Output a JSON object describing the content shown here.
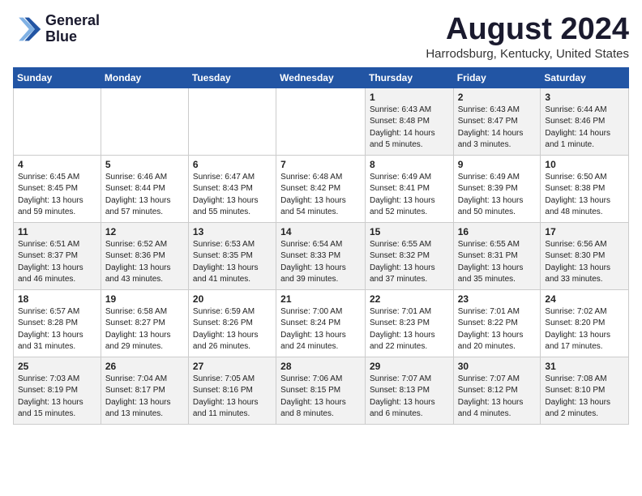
{
  "header": {
    "logo_line1": "General",
    "logo_line2": "Blue",
    "title": "August 2024",
    "subtitle": "Harrodsburg, Kentucky, United States"
  },
  "days_of_week": [
    "Sunday",
    "Monday",
    "Tuesday",
    "Wednesday",
    "Thursday",
    "Friday",
    "Saturday"
  ],
  "weeks": [
    [
      {
        "num": "",
        "info": ""
      },
      {
        "num": "",
        "info": ""
      },
      {
        "num": "",
        "info": ""
      },
      {
        "num": "",
        "info": ""
      },
      {
        "num": "1",
        "info": "Sunrise: 6:43 AM\nSunset: 8:48 PM\nDaylight: 14 hours\nand 5 minutes."
      },
      {
        "num": "2",
        "info": "Sunrise: 6:43 AM\nSunset: 8:47 PM\nDaylight: 14 hours\nand 3 minutes."
      },
      {
        "num": "3",
        "info": "Sunrise: 6:44 AM\nSunset: 8:46 PM\nDaylight: 14 hours\nand 1 minute."
      }
    ],
    [
      {
        "num": "4",
        "info": "Sunrise: 6:45 AM\nSunset: 8:45 PM\nDaylight: 13 hours\nand 59 minutes."
      },
      {
        "num": "5",
        "info": "Sunrise: 6:46 AM\nSunset: 8:44 PM\nDaylight: 13 hours\nand 57 minutes."
      },
      {
        "num": "6",
        "info": "Sunrise: 6:47 AM\nSunset: 8:43 PM\nDaylight: 13 hours\nand 55 minutes."
      },
      {
        "num": "7",
        "info": "Sunrise: 6:48 AM\nSunset: 8:42 PM\nDaylight: 13 hours\nand 54 minutes."
      },
      {
        "num": "8",
        "info": "Sunrise: 6:49 AM\nSunset: 8:41 PM\nDaylight: 13 hours\nand 52 minutes."
      },
      {
        "num": "9",
        "info": "Sunrise: 6:49 AM\nSunset: 8:39 PM\nDaylight: 13 hours\nand 50 minutes."
      },
      {
        "num": "10",
        "info": "Sunrise: 6:50 AM\nSunset: 8:38 PM\nDaylight: 13 hours\nand 48 minutes."
      }
    ],
    [
      {
        "num": "11",
        "info": "Sunrise: 6:51 AM\nSunset: 8:37 PM\nDaylight: 13 hours\nand 46 minutes."
      },
      {
        "num": "12",
        "info": "Sunrise: 6:52 AM\nSunset: 8:36 PM\nDaylight: 13 hours\nand 43 minutes."
      },
      {
        "num": "13",
        "info": "Sunrise: 6:53 AM\nSunset: 8:35 PM\nDaylight: 13 hours\nand 41 minutes."
      },
      {
        "num": "14",
        "info": "Sunrise: 6:54 AM\nSunset: 8:33 PM\nDaylight: 13 hours\nand 39 minutes."
      },
      {
        "num": "15",
        "info": "Sunrise: 6:55 AM\nSunset: 8:32 PM\nDaylight: 13 hours\nand 37 minutes."
      },
      {
        "num": "16",
        "info": "Sunrise: 6:55 AM\nSunset: 8:31 PM\nDaylight: 13 hours\nand 35 minutes."
      },
      {
        "num": "17",
        "info": "Sunrise: 6:56 AM\nSunset: 8:30 PM\nDaylight: 13 hours\nand 33 minutes."
      }
    ],
    [
      {
        "num": "18",
        "info": "Sunrise: 6:57 AM\nSunset: 8:28 PM\nDaylight: 13 hours\nand 31 minutes."
      },
      {
        "num": "19",
        "info": "Sunrise: 6:58 AM\nSunset: 8:27 PM\nDaylight: 13 hours\nand 29 minutes."
      },
      {
        "num": "20",
        "info": "Sunrise: 6:59 AM\nSunset: 8:26 PM\nDaylight: 13 hours\nand 26 minutes."
      },
      {
        "num": "21",
        "info": "Sunrise: 7:00 AM\nSunset: 8:24 PM\nDaylight: 13 hours\nand 24 minutes."
      },
      {
        "num": "22",
        "info": "Sunrise: 7:01 AM\nSunset: 8:23 PM\nDaylight: 13 hours\nand 22 minutes."
      },
      {
        "num": "23",
        "info": "Sunrise: 7:01 AM\nSunset: 8:22 PM\nDaylight: 13 hours\nand 20 minutes."
      },
      {
        "num": "24",
        "info": "Sunrise: 7:02 AM\nSunset: 8:20 PM\nDaylight: 13 hours\nand 17 minutes."
      }
    ],
    [
      {
        "num": "25",
        "info": "Sunrise: 7:03 AM\nSunset: 8:19 PM\nDaylight: 13 hours\nand 15 minutes."
      },
      {
        "num": "26",
        "info": "Sunrise: 7:04 AM\nSunset: 8:17 PM\nDaylight: 13 hours\nand 13 minutes."
      },
      {
        "num": "27",
        "info": "Sunrise: 7:05 AM\nSunset: 8:16 PM\nDaylight: 13 hours\nand 11 minutes."
      },
      {
        "num": "28",
        "info": "Sunrise: 7:06 AM\nSunset: 8:15 PM\nDaylight: 13 hours\nand 8 minutes."
      },
      {
        "num": "29",
        "info": "Sunrise: 7:07 AM\nSunset: 8:13 PM\nDaylight: 13 hours\nand 6 minutes."
      },
      {
        "num": "30",
        "info": "Sunrise: 7:07 AM\nSunset: 8:12 PM\nDaylight: 13 hours\nand 4 minutes."
      },
      {
        "num": "31",
        "info": "Sunrise: 7:08 AM\nSunset: 8:10 PM\nDaylight: 13 hours\nand 2 minutes."
      }
    ]
  ]
}
